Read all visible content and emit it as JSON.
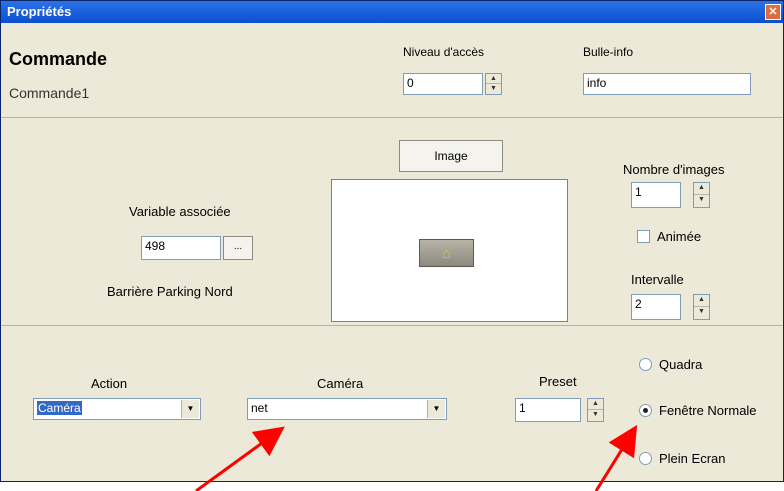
{
  "window": {
    "title": "Propriétés",
    "close_glyph": "✕"
  },
  "header": {
    "heading": "Commande",
    "name": "Commande1",
    "niveau_label": "Niveau d'accès",
    "niveau_value": "0",
    "bulle_label": "Bulle-info",
    "bulle_value": "info"
  },
  "image_section": {
    "image_button": "Image",
    "variable_label": "Variable associée",
    "variable_value": "498",
    "browse_label": "...",
    "variable_desc": "Barrière Parking Nord",
    "preview_icon": "home-icon",
    "nombre_label": "Nombre d'images",
    "nombre_value": "1",
    "animee_label": "Animée",
    "animee_checked": false,
    "intervalle_label": "Intervalle",
    "intervalle_value": "2"
  },
  "action_section": {
    "action_label": "Action",
    "action_value": "Caméra",
    "camera_label": "Caméra",
    "camera_value": "net",
    "preset_label": "Preset",
    "preset_value": "1",
    "radios": [
      {
        "label": "Quadra",
        "checked": false
      },
      {
        "label": "Fenêtre Normale",
        "checked": true
      },
      {
        "label": "Plein Ecran",
        "checked": false
      }
    ]
  },
  "colors": {
    "titlebar": "#0b4fd0",
    "dialog_bg": "#ece9d8",
    "arrow": "#ff0000",
    "selection": "#316ac5"
  }
}
